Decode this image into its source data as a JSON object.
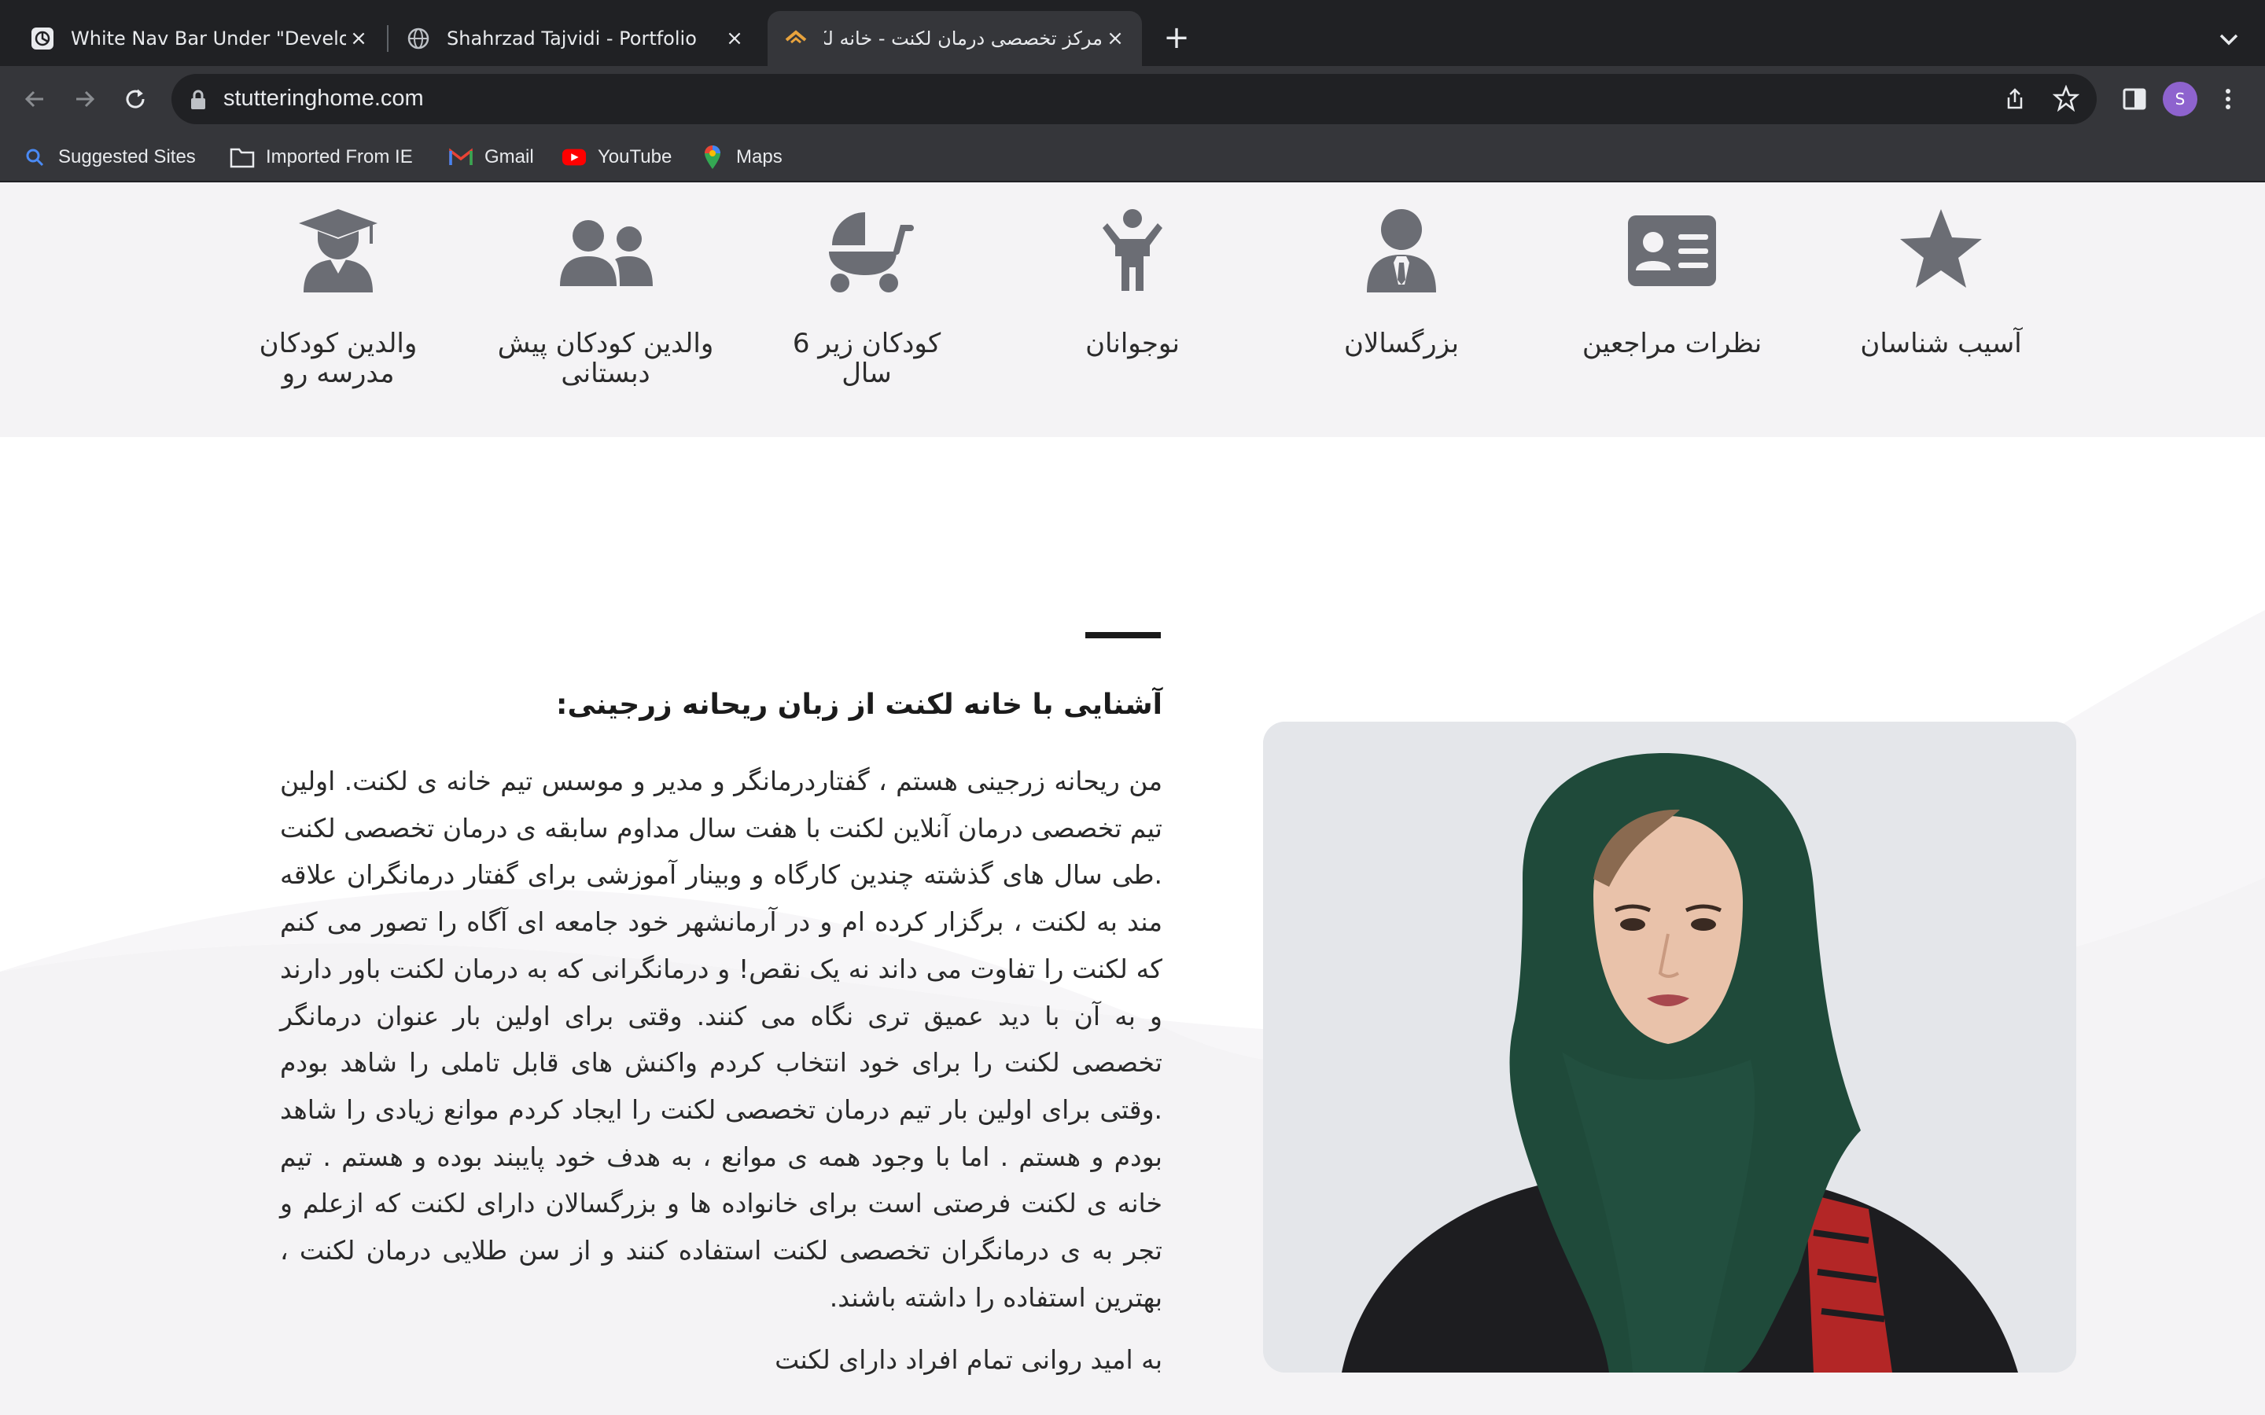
{
  "browser": {
    "tabs": [
      {
        "title": "White Nav Bar Under \"Develop",
        "favicon": "chatgpt-icon",
        "active": false
      },
      {
        "title": "Shahrzad Tajvidi - Portfolio",
        "favicon": "globe-icon",
        "active": false
      },
      {
        "title": "مرکز تخصصی درمان لکنت - خانه لکنت",
        "favicon": "stutteringhome-icon",
        "active": true
      }
    ],
    "url": "stutteringhome.com",
    "avatar_letter": "S",
    "bookmarks": [
      {
        "label": "Suggested Sites",
        "icon": "search-icon"
      },
      {
        "label": "Imported From IE",
        "icon": "folder-icon"
      },
      {
        "label": "Gmail",
        "icon": "gmail-icon"
      },
      {
        "label": "YouTube",
        "icon": "youtube-icon"
      },
      {
        "label": "Maps",
        "icon": "maps-pin-icon"
      }
    ]
  },
  "services": [
    {
      "label": "آسیب شناسان",
      "icon": "star-icon"
    },
    {
      "label": "نظرات مراجعین",
      "icon": "id-card-icon"
    },
    {
      "label": "بزرگسالان",
      "icon": "user-tie-icon"
    },
    {
      "label": "نوجوانان",
      "icon": "child-icon"
    },
    {
      "label": "کودکان زیر 6 سال",
      "icon": "baby-carriage-icon"
    },
    {
      "label": "والدین کودکان پیش دبستانی",
      "icon": "users-icon"
    },
    {
      "label": "والدین کودکان مدرسه رو",
      "icon": "user-graduate-icon"
    }
  ],
  "about": {
    "heading": "آشنایی با خانه لکنت از زبان ریحانه زرجینی:",
    "paragraph": "من ریحانه زرجینی هستم ، گفتاردرمانگر و مدیر و موسس تیم خانه ی لکنت. اولین تیم تخصصی درمان آنلاین لکنت با هفت سال مداوم سابقه ی درمان تخصصی لکنت .طی سال های گذشته چندین کارگاه و وبینار آموزشی برای گفتار درمانگران علاقه مند به لکنت ، برگزار کرده ام و در آرمانشهر خود جامعه ای آگاه را تصور می کنم که لکنت را تفاوت می داند نه یک نقص! و درمانگرانی که به درمان لکنت باور دارند و به آن با دید عمیق تری نگاه می کنند. وقتی برای اولین بار عنوان درمانگر تخصصی لکنت را برای خود انتخاب کردم واکنش های قابل تاملی را شاهد بودم .وقتی برای اولین بار تیم درمان تخصصی لکنت را ایجاد کردم موانع زیادی را شاهد بودم و هستم . اما با وجود همه ی موانع ، به هدف خود پایبند بوده و هستم . تیم خانه ی لکنت فرصتی است برای خانواده ها و بزرگسالان دارای لکنت که ازعلم و تجر به ی درمانگران تخصصی لکنت استفاده کنند و از سن طلایی درمان لکنت ، بهترین استفاده را داشته باشند.",
    "closing": "به امید روانی تمام افراد دارای لکنت"
  },
  "colors": {
    "icon_gray": "#6b6d74",
    "section_bg": "#f4f3f5",
    "chrome_dark": "#202124",
    "chrome_mid": "#35363a"
  }
}
